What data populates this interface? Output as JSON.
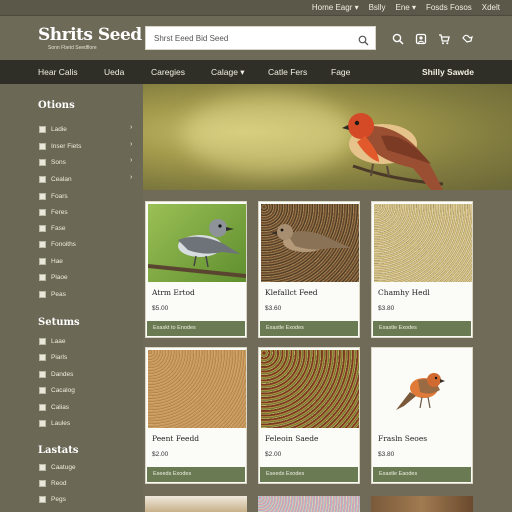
{
  "topbar": {
    "links": [
      "Home Eagr ▾",
      "Bslly",
      "Ene ▾",
      "Fosds Fosos",
      "Xdelt"
    ]
  },
  "header": {
    "logo_name": "Shrits Seed",
    "logo_tagline": "Sonn Fbetd Seedflore",
    "search_placeholder": "Shrst Eeed Bid Seed",
    "icons": [
      "search-icon",
      "profile-icon",
      "cart-icon",
      "settings-icon"
    ]
  },
  "nav": {
    "items": [
      "Hear Calis",
      "Ueda",
      "Caregies",
      "Calage ▾",
      "Catle Fers",
      "Fage"
    ],
    "special": "Shilly Sawde"
  },
  "sidebar": {
    "section1_title": "Otions",
    "section1_items": [
      "Ladie",
      "Inser Fiets",
      "Sons",
      "Cealan",
      "Foars",
      "Feres",
      "Fase",
      "Fonoiths",
      "Hae",
      "Plaoe",
      "Peas"
    ],
    "section2_title": "Setums",
    "section2_items": [
      "Laae",
      "Piarls",
      "Dandes",
      "Cacalog",
      "Calias",
      "Laules"
    ],
    "section3_title": "Lastats",
    "section3_items": [
      "Caatuge",
      "Reod",
      "Pegs"
    ]
  },
  "colors": {
    "accent_green": "#6a7a52",
    "nav_dark": "#2f2f27",
    "page_bg": "#6f6b58"
  },
  "products": [
    {
      "name": "Atrm Ertod",
      "price": "$5.00",
      "button": "Exaskt to Enodes"
    },
    {
      "name": "Klefallct Feed",
      "price": "$3.60",
      "button": "Exastle Exodes"
    },
    {
      "name": "Chamhy Hedl",
      "price": "$3.80",
      "button": "Exastle Exodes"
    },
    {
      "name": "Peent Feedd",
      "price": "$2.00",
      "button": "Eseeds Exodes"
    },
    {
      "name": "Feleoin Saede",
      "price": "$2.00",
      "button": "Eseeds Exodes"
    },
    {
      "name": "Frasln Seoes",
      "price": "$3.80",
      "button": "Exastle Eaodes"
    }
  ]
}
